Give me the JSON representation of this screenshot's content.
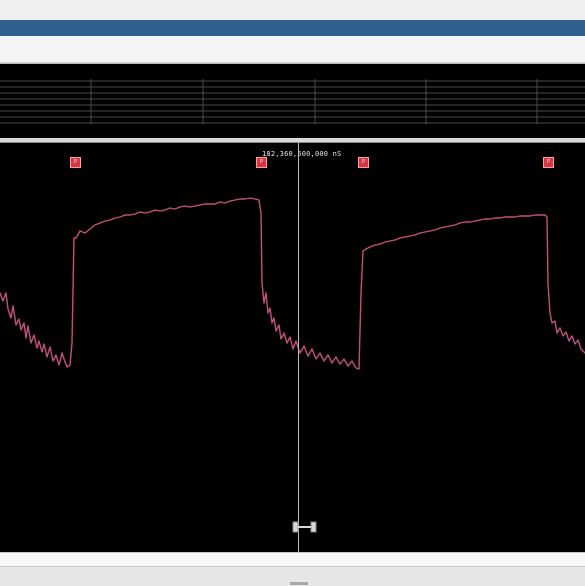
{
  "window": {
    "title": "",
    "accent": "#2f5f8f"
  },
  "scope": {
    "cursor_readout": "182,360,500,000 nS",
    "trace_color": "#c44f80",
    "marker_label": "P",
    "markers": [
      "P",
      "P",
      "P",
      "P"
    ],
    "cursor_line_color": "#bdbdbd"
  },
  "track_panel": {
    "label": ""
  }
}
